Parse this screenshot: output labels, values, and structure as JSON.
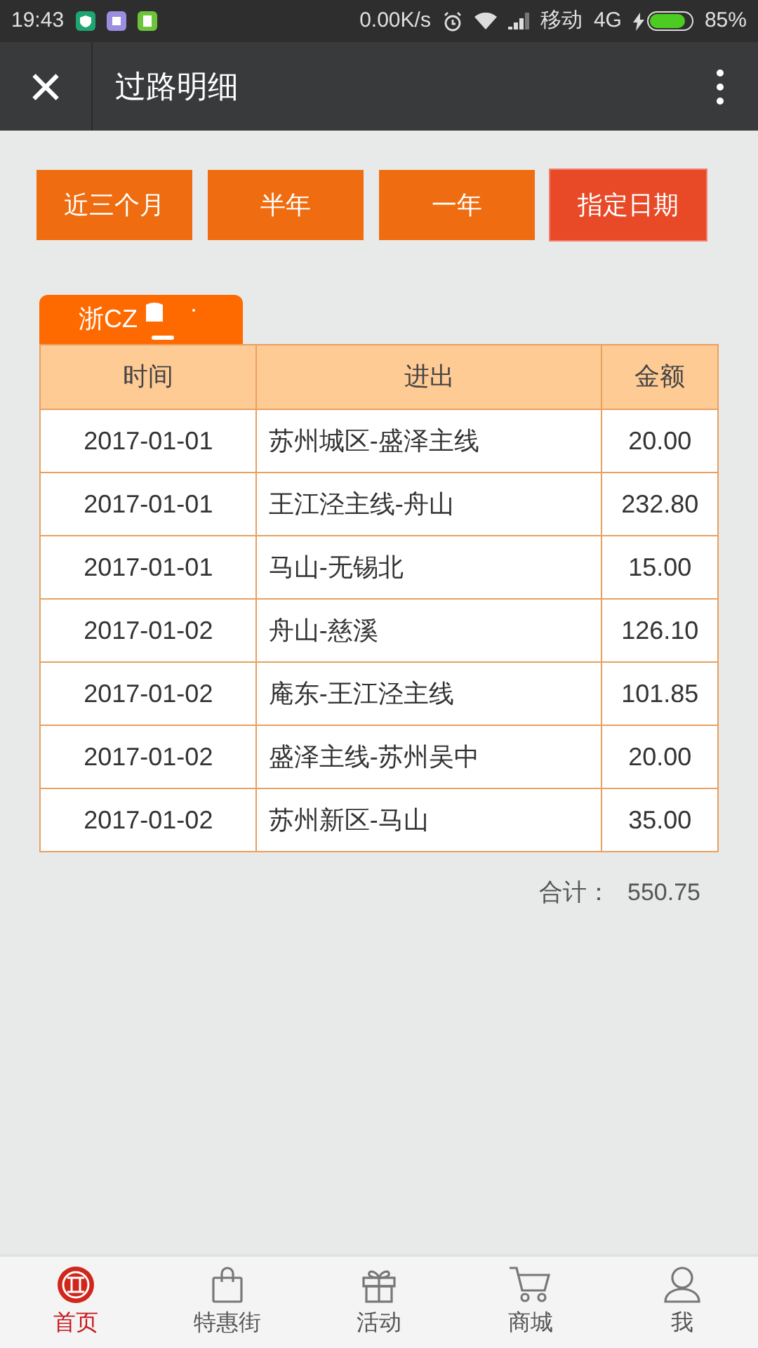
{
  "status_bar": {
    "time": "19:43",
    "speed": "0.00K/s",
    "carrier": "移动",
    "network": "4G",
    "battery": "85%"
  },
  "header": {
    "close": "×",
    "title": "过路明细"
  },
  "filters": [
    {
      "label": "近三个月",
      "selected": false
    },
    {
      "label": "半年",
      "selected": false
    },
    {
      "label": "一年",
      "selected": false
    },
    {
      "label": "指定日期",
      "selected": true
    }
  ],
  "plate_tab": {
    "label": "浙CZ"
  },
  "table": {
    "columns": [
      "时间",
      "进出",
      "金额"
    ],
    "rows": [
      [
        "2017-01-01",
        "苏州城区-盛泽主线",
        "20.00"
      ],
      [
        "2017-01-01",
        "王江泾主线-舟山",
        "232.80"
      ],
      [
        "2017-01-01",
        "马山-无锡北",
        "15.00"
      ],
      [
        "2017-01-02",
        "舟山-慈溪",
        "126.10"
      ],
      [
        "2017-01-02",
        "庵东-王江泾主线",
        "101.85"
      ],
      [
        "2017-01-02",
        "盛泽主线-苏州吴中",
        "20.00"
      ],
      [
        "2017-01-02",
        "苏州新区-马山",
        "35.00"
      ]
    ]
  },
  "total": {
    "label": "合计：",
    "value": "550.75"
  },
  "nav": [
    {
      "label": "首页",
      "kind": "logo",
      "selected": true
    },
    {
      "label": "特惠街",
      "kind": "bag",
      "selected": false
    },
    {
      "label": "活动",
      "kind": "gift",
      "selected": false
    },
    {
      "label": "商城",
      "kind": "cart",
      "selected": false
    },
    {
      "label": "我",
      "kind": "user",
      "selected": false
    }
  ]
}
